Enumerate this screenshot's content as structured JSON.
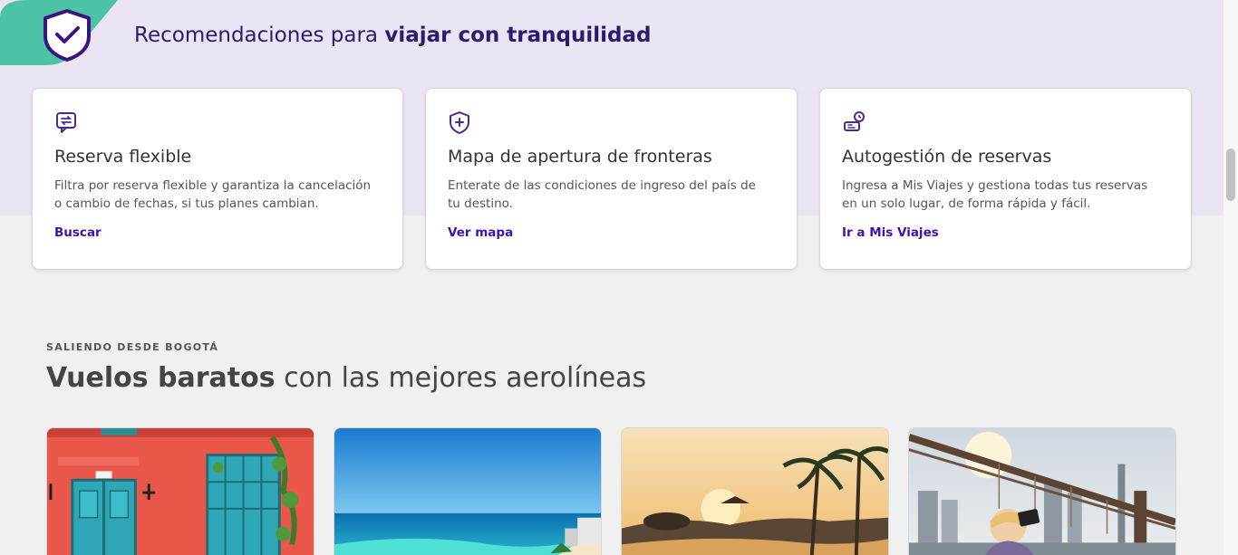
{
  "recommendations": {
    "title_prefix": "Recomendaciones para",
    "title_bold": "viajar con tranquilidad",
    "cards": [
      {
        "icon": "flexible-booking-icon",
        "title": "Reserva flexible",
        "description": "Filtra por reserva flexible y garantiza la cancelación o cambio de fechas, si tus planes cambian.",
        "link": "Buscar"
      },
      {
        "icon": "shield-plus-icon",
        "title": "Mapa de apertura de fronteras",
        "description": "Enterate de las condiciones de ingreso del país de tu destino.",
        "link": "Ver mapa"
      },
      {
        "icon": "self-service-icon",
        "title": "Autogestión de reservas",
        "description": "Ingresa a Mis Viajes y gestiona todas tus reservas en un solo lugar, de forma rápida y fácil.",
        "link": "Ir a Mis Viajes"
      }
    ]
  },
  "flights": {
    "eyebrow": "SALIENDO DESDE BOGOTÁ",
    "title_bold": "Vuelos baratos",
    "title_rest": "con las mejores aerolíneas"
  },
  "colors": {
    "band": "#ebe4f5",
    "brand_purple": "#3b13b5",
    "teal": "#4cc3a5"
  }
}
